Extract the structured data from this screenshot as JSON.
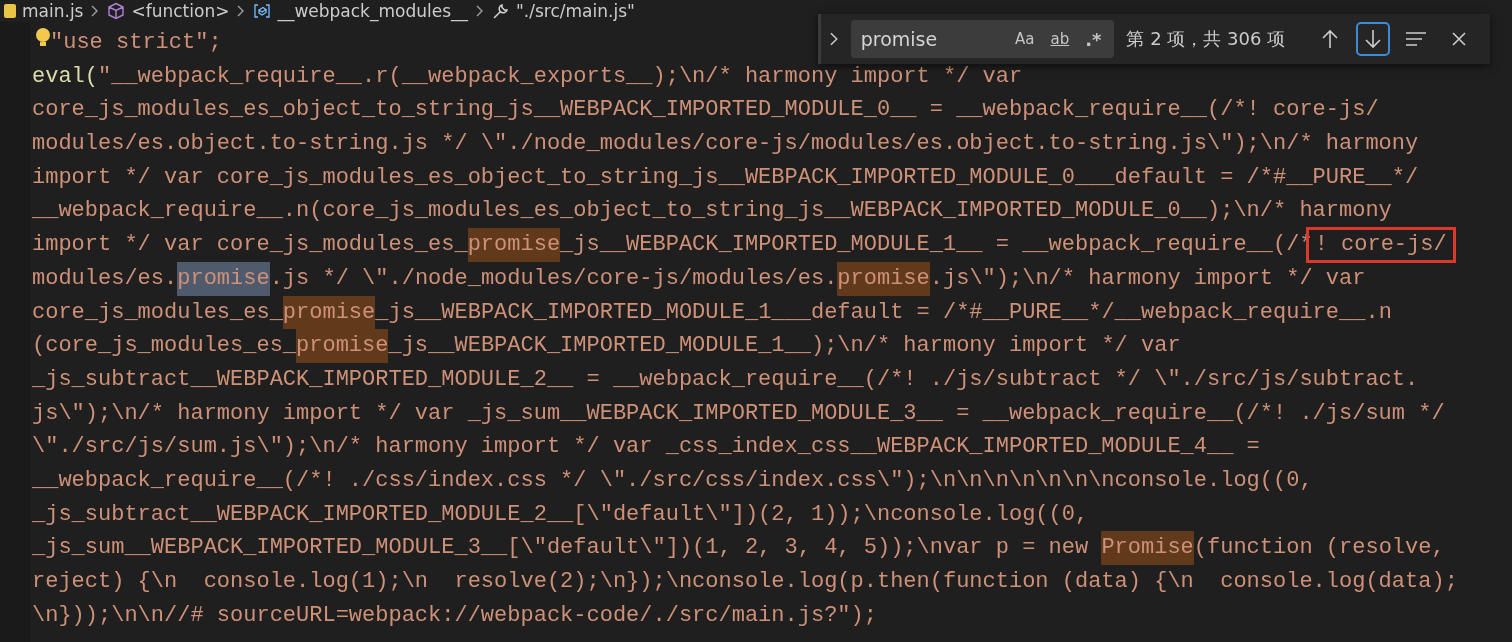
{
  "breadcrumb": [
    {
      "kind": "file",
      "label": "main.js"
    },
    {
      "kind": "function",
      "label": "<function>"
    },
    {
      "kind": "variable",
      "label": "__webpack_modules__"
    },
    {
      "kind": "key",
      "label": "\"./src/main.js\""
    }
  ],
  "find_widget": {
    "value": "promise",
    "toggles": [
      {
        "label": "Aa",
        "on": false
      },
      {
        "label": "ab",
        "on": false
      },
      {
        "label": ".*",
        "on": false
      }
    ],
    "result": "第 2 项，共 306 项",
    "buttons": [
      {
        "kind": "previous",
        "focused": false
      },
      {
        "kind": "next",
        "focused": true
      },
      {
        "kind": "selection",
        "focused": false
      },
      {
        "kind": "close",
        "focused": false
      }
    ]
  },
  "lines": [
    {
      "segments": [
        {
          "kind": "plain",
          "text": "\"use strict\";"
        }
      ]
    },
    {
      "segments": [
        {
          "kind": "function",
          "text": "eval("
        },
        {
          "kind": "plain",
          "text": "\"__webpack_require__.r(__webpack_exports__);\\n/* harmony import */ var"
        }
      ]
    },
    {
      "segments": [
        {
          "kind": "plain",
          "text": "core_js_modules_es_object_to_string_js__WEBPACK_IMPORTED_MODULE_0__ = __webpack_require__(/*! core-js/"
        }
      ]
    },
    {
      "segments": [
        {
          "kind": "plain",
          "text": "modules/es.object.to-string.js */ \\\"./node_modules/core-js/modules/es.object.to-string.js\\\");\\n/* harmony"
        }
      ]
    },
    {
      "segments": [
        {
          "kind": "plain",
          "text": "import */ var core_js_modules_es_object_to_string_js__WEBPACK_IMPORTED_MODULE_0___default = /*#__PURE__*/"
        }
      ]
    },
    {
      "segments": [
        {
          "kind": "plain",
          "text": "__webpack_require__.n(core_js_modules_es_object_to_string_js__WEBPACK_IMPORTED_MODULE_0__);\\n/* harmony"
        }
      ]
    },
    {
      "segments": [
        {
          "kind": "plain",
          "text": "import */ var core_js_modules_es_"
        },
        {
          "kind": "match",
          "text": "promise"
        },
        {
          "kind": "plain",
          "text": "_js__WEBPACK_IMPORTED_MODULE_1__ = __webpack_require__(/*"
        },
        {
          "kind": "annotated",
          "text": "! core-js/"
        }
      ]
    },
    {
      "segments": [
        {
          "kind": "plain",
          "text": "modules/es."
        },
        {
          "kind": "current",
          "text": "promise"
        },
        {
          "kind": "plain",
          "text": ".js */ \\\"./node_modules/core-js/modules/es."
        },
        {
          "kind": "match",
          "text": "promise"
        },
        {
          "kind": "plain",
          "text": ".js\\\");\\n/* harmony import */ var"
        }
      ]
    },
    {
      "segments": [
        {
          "kind": "plain",
          "text": "core_js_modules_es_"
        },
        {
          "kind": "match",
          "text": "promise"
        },
        {
          "kind": "plain",
          "text": "_js__WEBPACK_IMPORTED_MODULE_1___default = /*#__PURE__*/__webpack_require__.n"
        }
      ]
    },
    {
      "segments": [
        {
          "kind": "plain",
          "text": "(core_js_modules_es_"
        },
        {
          "kind": "match",
          "text": "promise"
        },
        {
          "kind": "plain",
          "text": "_js__WEBPACK_IMPORTED_MODULE_1__);\\n/* harmony import */ var"
        }
      ]
    },
    {
      "segments": [
        {
          "kind": "plain",
          "text": "_js_subtract__WEBPACK_IMPORTED_MODULE_2__ = __webpack_require__(/*! ./js/subtract */ \\\"./src/js/subtract."
        }
      ]
    },
    {
      "segments": [
        {
          "kind": "plain",
          "text": "js\\\");\\n/* harmony import */ var _js_sum__WEBPACK_IMPORTED_MODULE_3__ = __webpack_require__(/*! ./js/sum */"
        }
      ]
    },
    {
      "segments": [
        {
          "kind": "plain",
          "text": "\\\"./src/js/sum.js\\\");\\n/* harmony import */ var _css_index_css__WEBPACK_IMPORTED_MODULE_4__ ="
        }
      ]
    },
    {
      "segments": [
        {
          "kind": "plain",
          "text": "__webpack_require__(/*! ./css/index.css */ \\\"./src/css/index.css\\\");\\n\\n\\n\\n\\n\\n\\nconsole.log((0,"
        }
      ]
    },
    {
      "segments": [
        {
          "kind": "plain",
          "text": "_js_subtract__WEBPACK_IMPORTED_MODULE_2__[\\\"default\\\"])(2, 1));\\nconsole.log((0,"
        }
      ]
    },
    {
      "segments": [
        {
          "kind": "plain",
          "text": "_js_sum__WEBPACK_IMPORTED_MODULE_3__[\\\"default\\\"])(1, 2, 3, 4, 5));\\nvar p = new "
        },
        {
          "kind": "match",
          "text": "Promise"
        },
        {
          "kind": "plain",
          "text": "(function (resolve,"
        }
      ]
    },
    {
      "segments": [
        {
          "kind": "plain",
          "text": "reject) {\\n  console.log(1);\\n  resolve(2);\\n});\\nconsole.log(p.then(function (data) {\\n  console.log(data);"
        }
      ]
    },
    {
      "segments": [
        {
          "kind": "plain",
          "text": "\\n}));\\n\\n//# sourceURL=webpack://webpack-code/./src/main.js?\");"
        }
      ]
    }
  ]
}
